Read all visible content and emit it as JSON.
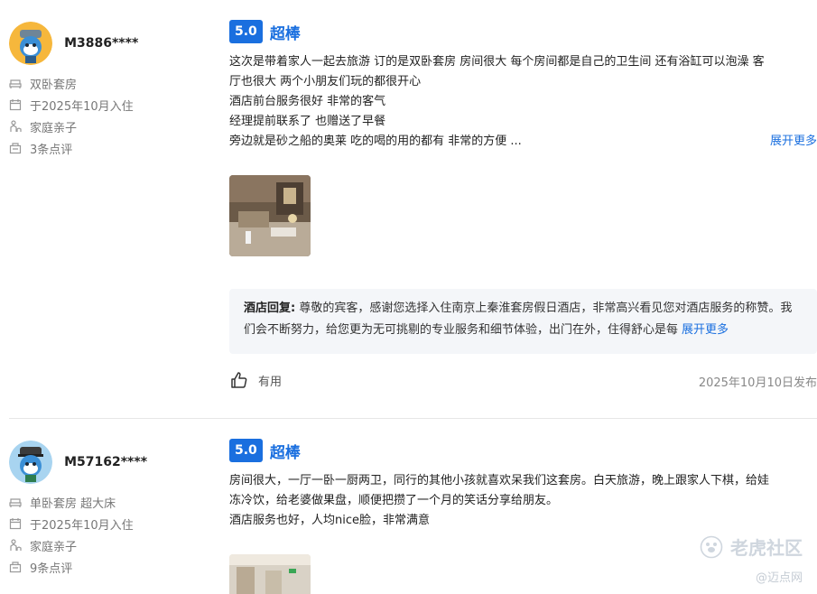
{
  "reviews": [
    {
      "username": "M3886****",
      "meta": [
        "双卧套房",
        "于2025年10月入住",
        "家庭亲子",
        "3条点评"
      ],
      "score": "5.0",
      "score_label": "超棒",
      "lines": [
        "这次是带着家人一起去旅游 订的是双卧套房 房间很大 每个房间都是自己的卫生间 还有浴缸可以泡澡 客",
        "厅也很大 两个小朋友们玩的都很开心",
        "酒店前台服务很好 非常的客气",
        "经理提前联系了 也赠送了早餐",
        "旁边就是砂之船的奥莱 吃的喝的用的都有 非常的方便 ..."
      ],
      "expand_label": "展开更多",
      "reply_label": "酒店回复:",
      "reply_text": "尊敬的宾客，感谢您选择入住南京上秦淮套房假日酒店，非常高兴看见您对酒店服务的称赞。我们会不断努力，给您更为无可挑剔的专业服务和细节体验，出门在外，住得舒心是每",
      "reply_expand": "展开更多",
      "helpful_label": "有用",
      "date": "2025年10月10日发布"
    },
    {
      "username": "M57162****",
      "meta": [
        "单卧套房 超大床",
        "于2025年10月入住",
        "家庭亲子",
        "9条点评"
      ],
      "score": "5.0",
      "score_label": "超棒",
      "lines": [
        "房间很大，一厅一卧一厨两卫，同行的其他小孩就喜欢呆我们这套房。白天旅游，晚上跟家人下棋，给娃",
        "冻冷饮，给老婆做果盘，顺便把攒了一个月的笑话分享给朋友。",
        "酒店服务也好，人均nice脸，非常满意"
      ]
    }
  ],
  "watermark": {
    "main": "老虎社区",
    "sub": "@迈点网"
  },
  "colors": {
    "accent": "#1a6fdf",
    "reply_bg": "#f4f6f9"
  }
}
